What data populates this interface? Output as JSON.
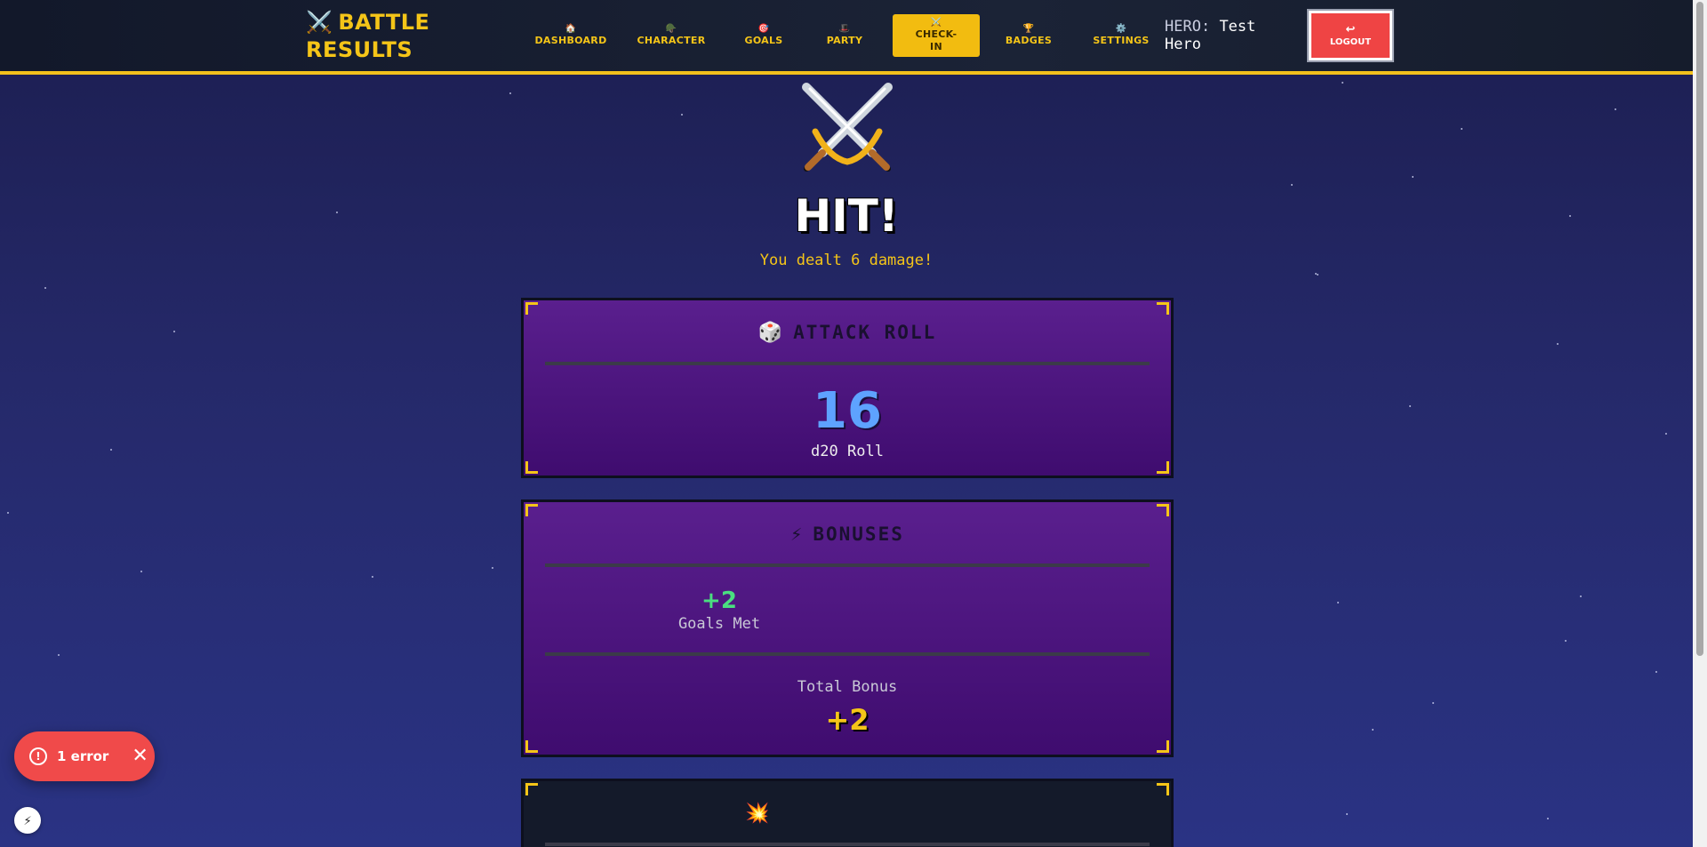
{
  "header": {
    "logo_icon": "⚔️",
    "logo_text": "BATTLE RESULTS",
    "nav": [
      {
        "icon": "🏠",
        "label": "DASHBOARD",
        "active": false
      },
      {
        "icon": "🪖",
        "label": "CHARACTER",
        "active": false
      },
      {
        "icon": "🎯",
        "label": "GOALS",
        "active": false
      },
      {
        "icon": "🎩",
        "label": "PARTY",
        "active": false
      },
      {
        "icon": "⚔️",
        "label": "CHECK-IN",
        "active": true
      },
      {
        "icon": "🏆",
        "label": "BADGES",
        "active": false
      },
      {
        "icon": "⚙️",
        "label": "SETTINGS",
        "active": false
      }
    ],
    "hero_label": "HERO:",
    "hero_name": "Test Hero",
    "logout_icon": "↩",
    "logout_label": "LOGOUT"
  },
  "result": {
    "icon": "crossed-swords-icon",
    "title": "HIT!",
    "subtitle": "You dealt 6 damage!"
  },
  "attack_card": {
    "icon": "🎲",
    "title": "ATTACK ROLL",
    "roll_value": "16",
    "roll_label": "d20 Roll"
  },
  "bonuses_card": {
    "icon": "⚡",
    "title": "BONUSES",
    "bonus_value": "+2",
    "bonus_label": "Goals Met",
    "total_label": "Total Bonus",
    "total_value": "+2"
  },
  "damage_card": {
    "icon": "💥"
  },
  "overlay": {
    "error_icon": "!",
    "error_text": "1 error",
    "close_icon": "✕",
    "devtools_icon": "⚡"
  },
  "colors": {
    "accent": "#f5c518",
    "danger": "#ef4444",
    "roll": "#5ea2ff",
    "bonus": "#4ade80"
  }
}
